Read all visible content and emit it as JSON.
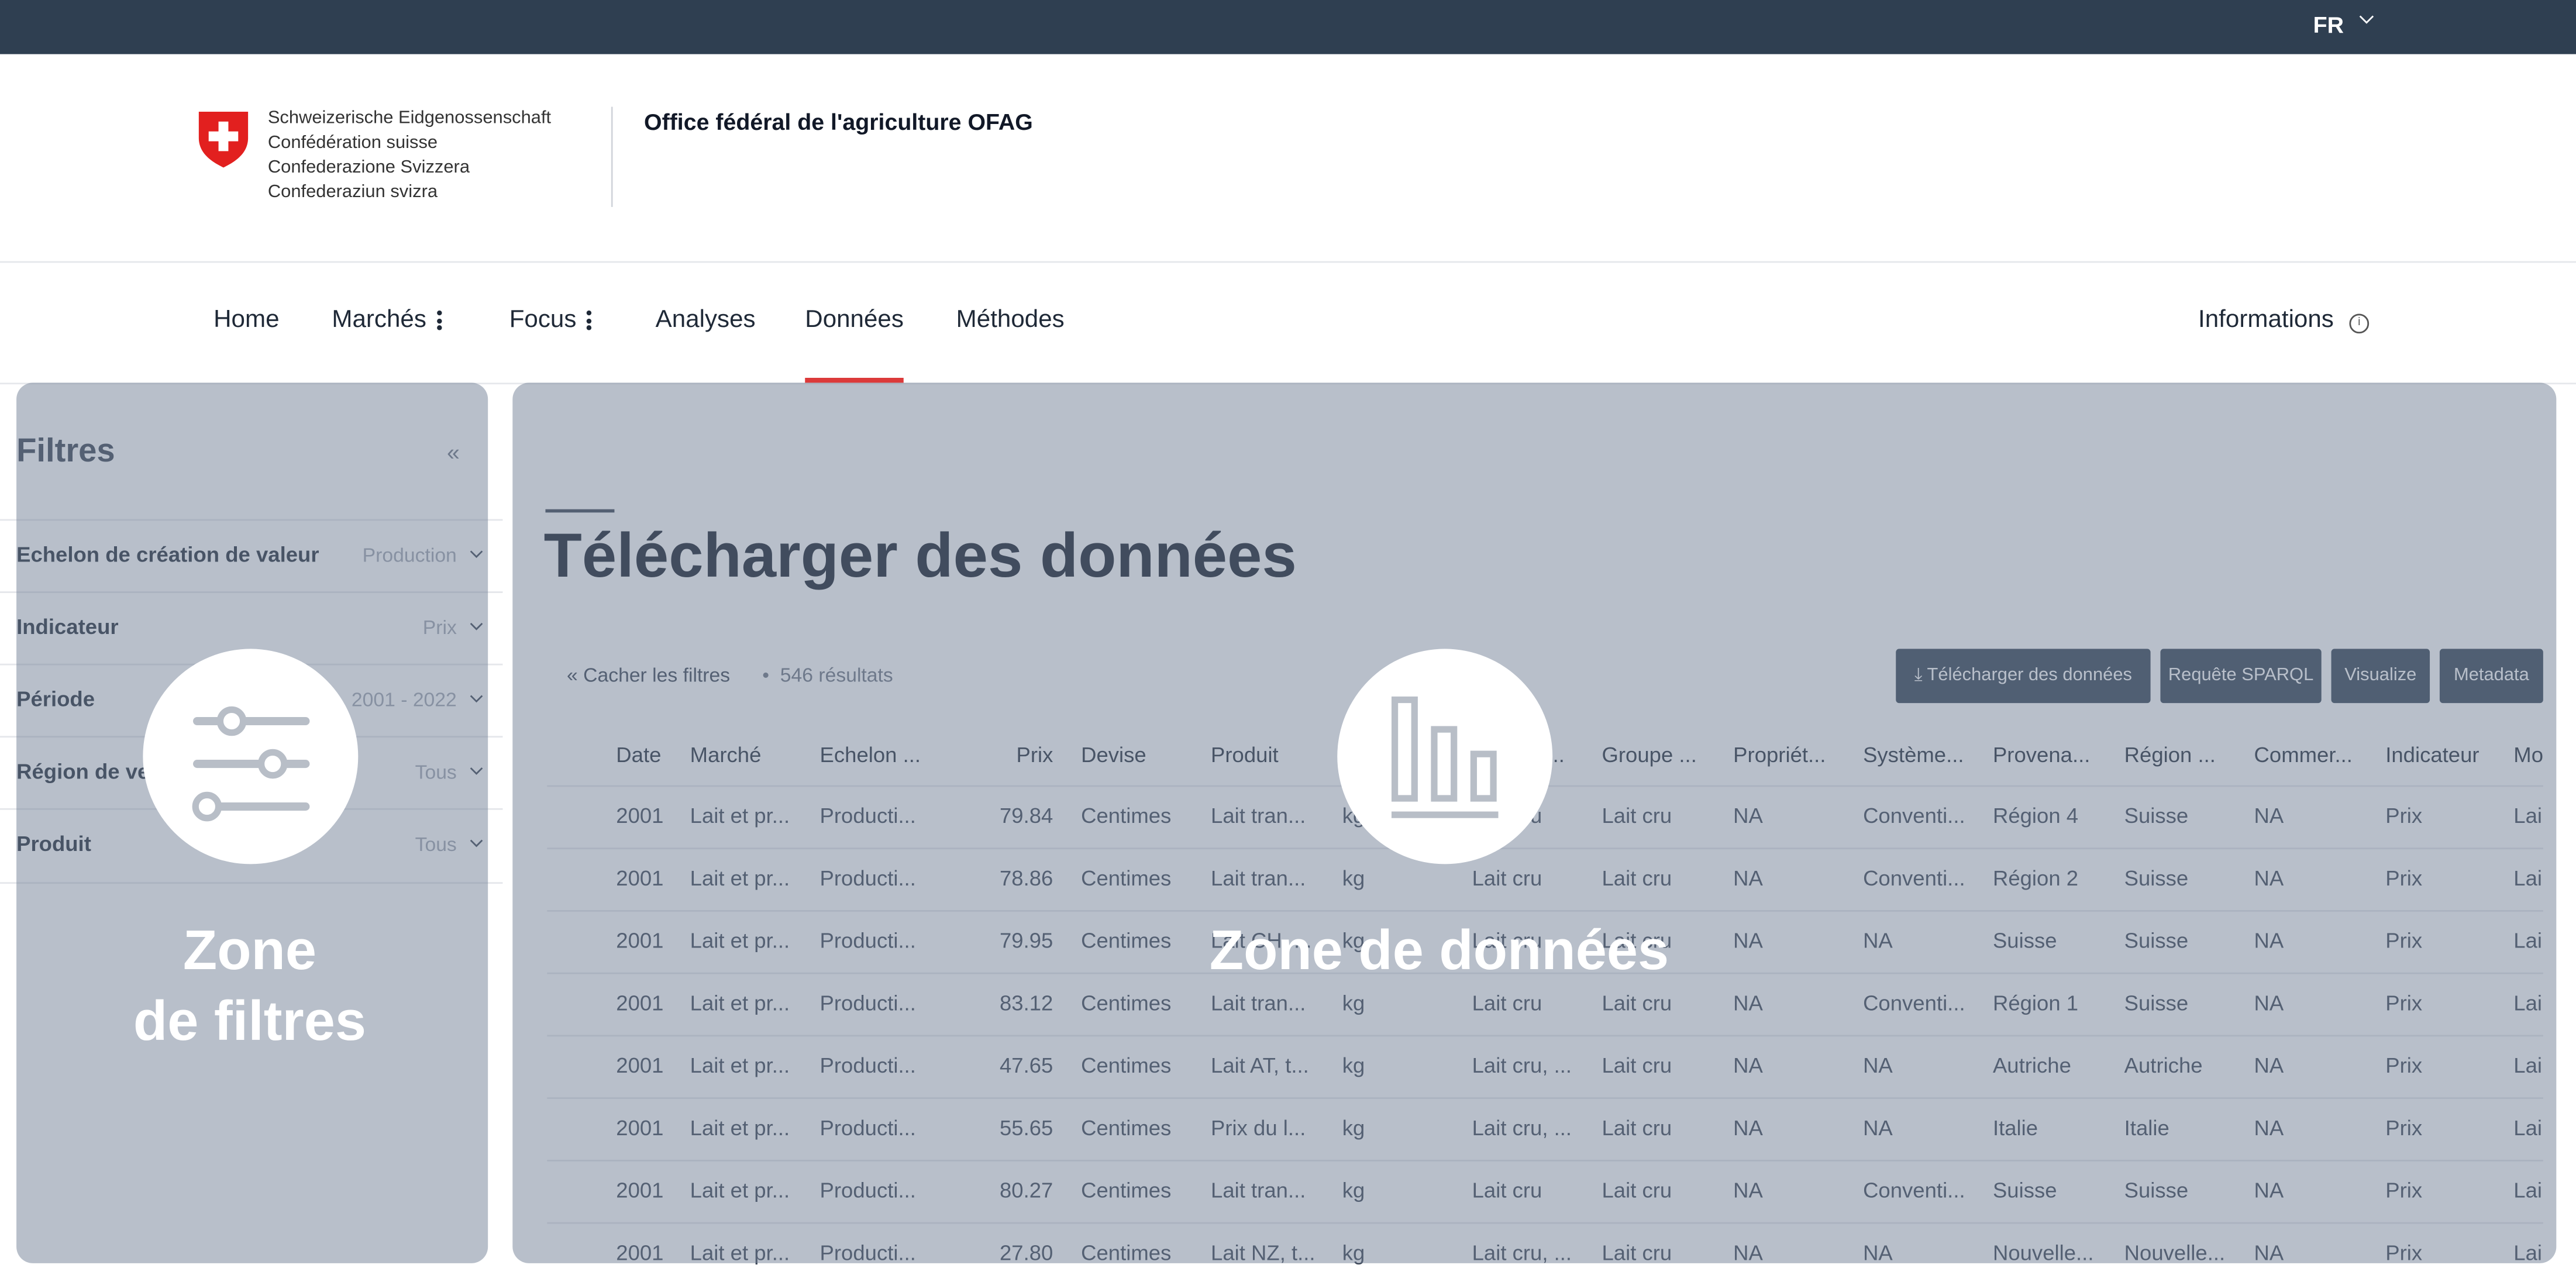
{
  "topbar": {
    "language": "FR"
  },
  "header": {
    "confederation_lines": [
      "Schweizerische Eidgenossenschaft",
      "Confédération suisse",
      "Confederazione Svizzera",
      "Confederaziun svizra"
    ],
    "office": "Office fédéral de l'agriculture OFAG"
  },
  "nav": {
    "items": [
      {
        "label": "Home"
      },
      {
        "label": "Marchés"
      },
      {
        "label": "Focus"
      },
      {
        "label": "Analyses"
      },
      {
        "label": "Données"
      },
      {
        "label": "Méthodes"
      }
    ],
    "active": "Données",
    "info_label": "Informations"
  },
  "filters": {
    "title": "Filtres",
    "collapse_icon": "double-chevron-left-icon",
    "rows": [
      {
        "label": "Echelon de création de valeur",
        "value": "Production"
      },
      {
        "label": "Indicateur",
        "value": "Prix"
      },
      {
        "label": "Période",
        "value": "2001 - 2022"
      },
      {
        "label": "Région de vente",
        "value": "Tous"
      },
      {
        "label": "Produit",
        "value": "Tous"
      }
    ]
  },
  "data": {
    "title": "Télécharger des données",
    "hide_filters": "Cacher les filtres",
    "results": "546 résultats",
    "buttons": {
      "download": "Télécharger des données",
      "sparql": "Requête SPARQL",
      "visualize": "Visualize",
      "metadata": "Metadata"
    },
    "columns": [
      "Date",
      "Marché",
      "Echelon ...",
      "Prix",
      "Devise",
      "Produit",
      "Unité",
      "Propriét...",
      "Groupe ...",
      "Propriét...",
      "Système...",
      "Provena...",
      "Région ...",
      "Commer...",
      "Indicateur",
      "Mo"
    ],
    "rows": [
      [
        "2001",
        "Lait et pr...",
        "Producti...",
        "79.84",
        "Centimes",
        "Lait tran...",
        "kg",
        "Lait cru",
        "Lait cru",
        "NA",
        "Conventi...",
        "Région 4",
        "Suisse",
        "NA",
        "Prix",
        "Lai"
      ],
      [
        "2001",
        "Lait et pr...",
        "Producti...",
        "78.86",
        "Centimes",
        "Lait tran...",
        "kg",
        "Lait cru",
        "Lait cru",
        "NA",
        "Conventi...",
        "Région 2",
        "Suisse",
        "NA",
        "Prix",
        "Lai"
      ],
      [
        "2001",
        "Lait et pr...",
        "Producti...",
        "79.95",
        "Centimes",
        "Lait CH, ...",
        "kg",
        "Lait cru",
        "Lait cru",
        "NA",
        "NA",
        "Suisse",
        "Suisse",
        "NA",
        "Prix",
        "Lai"
      ],
      [
        "2001",
        "Lait et pr...",
        "Producti...",
        "83.12",
        "Centimes",
        "Lait tran...",
        "kg",
        "Lait cru",
        "Lait cru",
        "NA",
        "Conventi...",
        "Région 1",
        "Suisse",
        "NA",
        "Prix",
        "Lai"
      ],
      [
        "2001",
        "Lait et pr...",
        "Producti...",
        "47.65",
        "Centimes",
        "Lait AT, t...",
        "kg",
        "Lait cru, ...",
        "Lait cru",
        "NA",
        "NA",
        "Autriche",
        "Autriche",
        "NA",
        "Prix",
        "Lai"
      ],
      [
        "2001",
        "Lait et pr...",
        "Producti...",
        "55.65",
        "Centimes",
        "Prix du l...",
        "kg",
        "Lait cru, ...",
        "Lait cru",
        "NA",
        "NA",
        "Italie",
        "Italie",
        "NA",
        "Prix",
        "Lai"
      ],
      [
        "2001",
        "Lait et pr...",
        "Producti...",
        "80.27",
        "Centimes",
        "Lait tran...",
        "kg",
        "Lait cru",
        "Lait cru",
        "NA",
        "Conventi...",
        "Suisse",
        "Suisse",
        "NA",
        "Prix",
        "Lai"
      ],
      [
        "2001",
        "Lait et pr...",
        "Producti...",
        "27.80",
        "Centimes",
        "Lait NZ, t...",
        "kg",
        "Lait cru, ...",
        "Lait cru",
        "NA",
        "NA",
        "Nouvelle...",
        "Nouvelle...",
        "NA",
        "Prix",
        "Lai"
      ]
    ]
  },
  "overlays": {
    "filters_zone": {
      "line1": "Zone",
      "line2": "de filtres",
      "icon": "sliders-icon"
    },
    "data_zone": {
      "label": "Zone de données",
      "icon": "bar-chart-icon"
    }
  },
  "colors": {
    "topbar": "#2f3f51",
    "accent_red": "#dc3a3a",
    "swiss_red": "#e2201f",
    "overlay": "#718096",
    "button": "#2f3f51"
  }
}
